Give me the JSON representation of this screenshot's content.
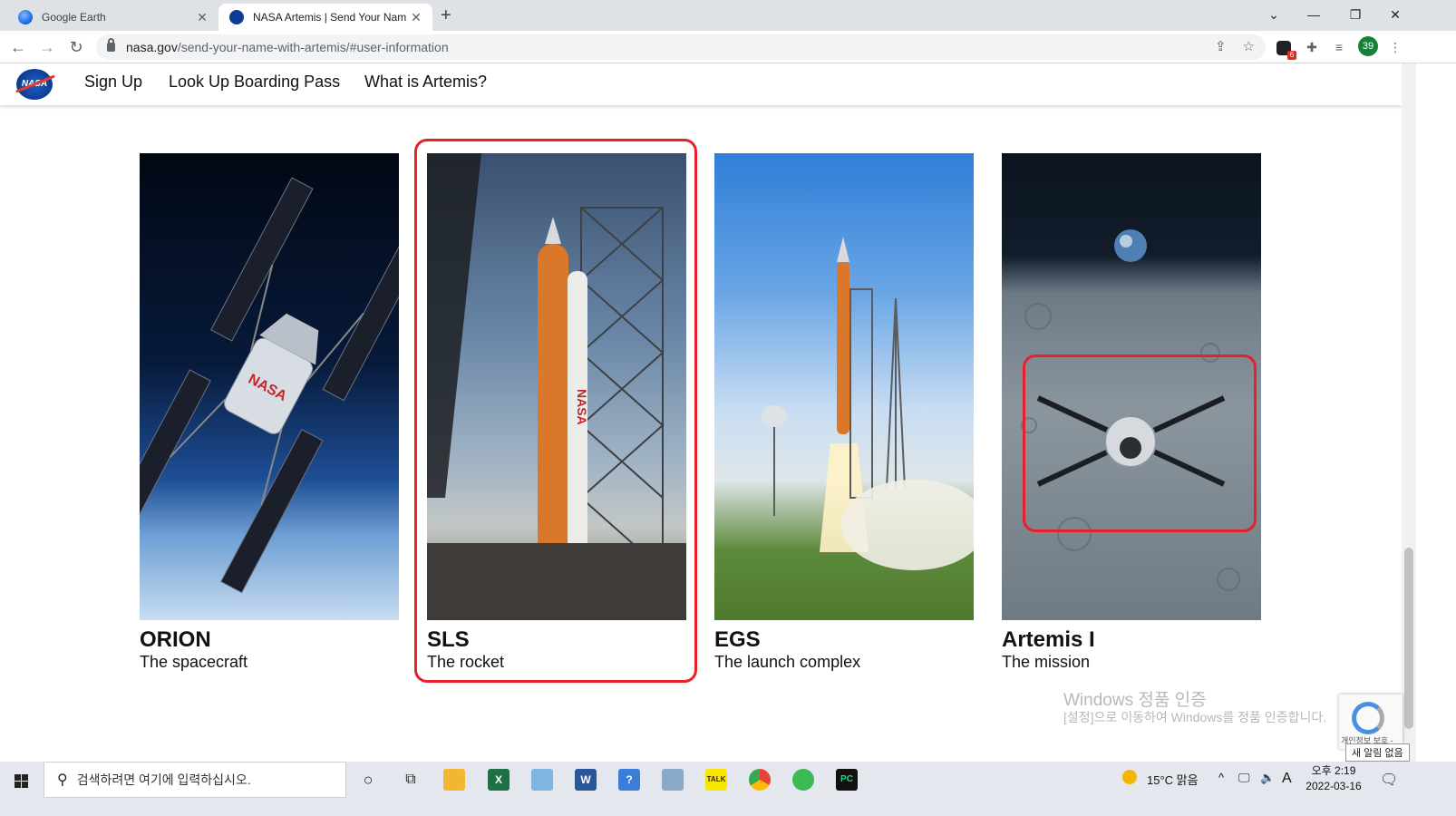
{
  "browser": {
    "tabs": [
      {
        "title": "Google Earth",
        "active": false,
        "favicon": "google-earth-icon"
      },
      {
        "title": "NASA Artemis | Send Your Nam",
        "active": true,
        "favicon": "nasa-icon"
      }
    ],
    "new_tab": "+",
    "address": {
      "domain": "nasa.gov",
      "path": "/send-your-name-with-artemis/#user-information"
    },
    "profile_label": "39",
    "extension_badge": "6"
  },
  "site": {
    "logo_text": "NASA",
    "nav": [
      "Sign Up",
      "Look Up Boarding Pass",
      "What is Artemis?"
    ]
  },
  "cards": [
    {
      "title": "ORION",
      "subtitle": "The spacecraft",
      "image": "orion-spacecraft-image"
    },
    {
      "title": "SLS",
      "subtitle": "The rocket",
      "image": "sls-rocket-image"
    },
    {
      "title": "EGS",
      "subtitle": "The launch complex",
      "image": "launch-complex-image"
    },
    {
      "title": "Artemis I",
      "subtitle": "The mission",
      "image": "artemis-mission-image"
    }
  ],
  "annotation_color": "#e8202a",
  "watermark": {
    "line1": "Windows 정품 인증",
    "line2": "[설정]으로 이동하여 Windows를 정품 인증합니다."
  },
  "recaptcha": {
    "label": "개인정보 보호 -",
    "notice": "새 알림 없음"
  },
  "taskbar": {
    "search_placeholder": "검색하려면 여기에 입력하십시오.",
    "weather": "15°C  맑음",
    "ime": "A",
    "time": "오후 2:19",
    "date": "2022-03-16"
  }
}
